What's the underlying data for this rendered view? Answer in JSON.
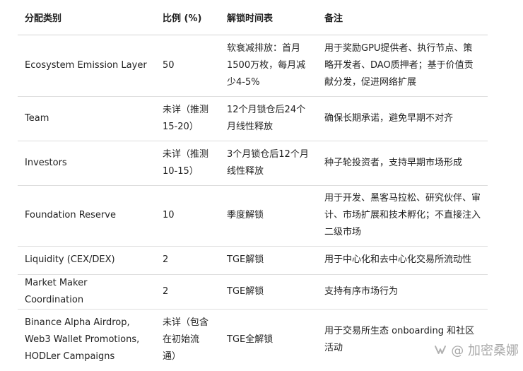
{
  "table": {
    "headers": [
      "分配类别",
      "比例 (%)",
      "解锁时间表",
      "备注"
    ],
    "rows": [
      {
        "category": "Ecosystem Emission Layer",
        "ratio": "50",
        "unlock": "软衰减排放：首月1500万枚，每月减少4-5%",
        "note": "用于奖励GPU提供者、执行节点、策略开发者、DAO质押者；基于价值贡献分发，促进网络扩展"
      },
      {
        "category": "Team",
        "ratio": "未详（推测15-20）",
        "unlock": "12个月锁仓后24个月线性释放",
        "note": "确保长期承诺，避免早期不对齐"
      },
      {
        "category": "Investors",
        "ratio": "未详（推测10-15）",
        "unlock": "3个月锁仓后12个月线性释放",
        "note": "种子轮投资者，支持早期市场形成"
      },
      {
        "category": "Foundation Reserve",
        "ratio": "10",
        "unlock": "季度解锁",
        "note": "用于开发、黑客马拉松、研究伙伴、审计、市场扩展和技术孵化；不直接注入二级市场"
      },
      {
        "category": "Liquidity (CEX/DEX)",
        "ratio": "2",
        "unlock": "TGE解锁",
        "note": "用于中心化和去中心化交易所流动性"
      },
      {
        "category": "Market Maker Coordination",
        "ratio": "2",
        "unlock": "TGE解锁",
        "note": "支持有序市场行为"
      },
      {
        "category": "Binance Alpha Airdrop, Web3 Wallet Promotions, HODLer Campaigns",
        "ratio": "未详（包含在初始流通）",
        "unlock": "TGE全解锁",
        "note": "用于交易所生态 onboarding 和社区活动"
      }
    ]
  },
  "watermark": {
    "icon": "wechat-channel-icon",
    "text": "@ 加密桑娜"
  }
}
